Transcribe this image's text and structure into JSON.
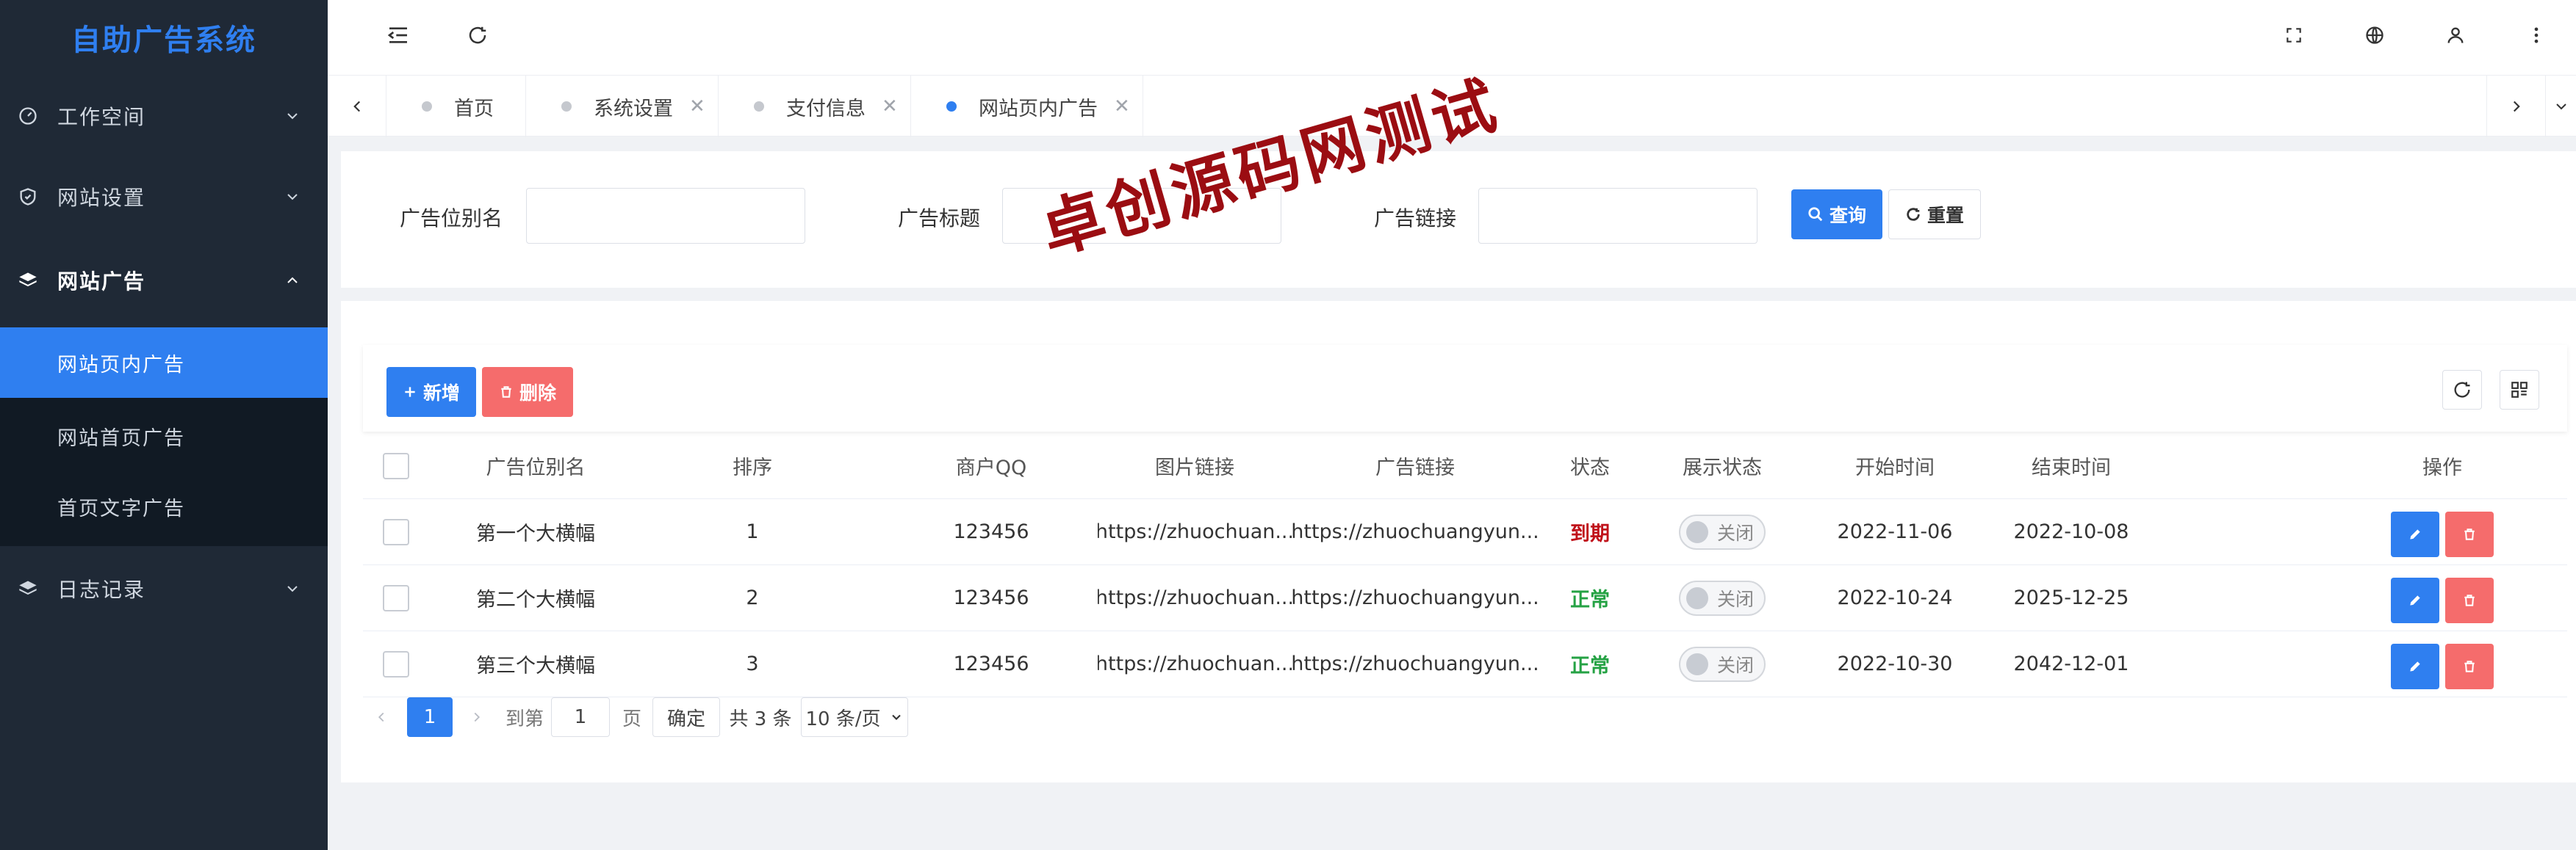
{
  "app": {
    "title": "自助广告系统"
  },
  "sidebar": {
    "items": [
      {
        "label": "工作空间",
        "icon": "dashboard-icon"
      },
      {
        "label": "网站设置",
        "icon": "shield-icon"
      },
      {
        "label": "网站广告",
        "icon": "layers-icon"
      },
      {
        "label": "日志记录",
        "icon": "layers-icon"
      }
    ],
    "sub_items": [
      {
        "label": "网站页内广告"
      },
      {
        "label": "网站首页广告"
      },
      {
        "label": "首页文字广告"
      }
    ]
  },
  "tabs": [
    {
      "label": "首页"
    },
    {
      "label": "系统设置"
    },
    {
      "label": "支付信息"
    },
    {
      "label": "网站页内广告"
    }
  ],
  "search": {
    "field1_label": "广告位别名",
    "field2_label": "广告标题",
    "field3_label": "广告链接",
    "query_label": "查询",
    "reset_label": "重置"
  },
  "toolbar": {
    "add_label": "新增",
    "delete_label": "删除"
  },
  "table": {
    "headers": [
      "广告位别名",
      "排序",
      "商户QQ",
      "图片链接",
      "广告链接",
      "状态",
      "展示状态",
      "开始时间",
      "结束时间",
      "操作"
    ],
    "rows": [
      {
        "name": "第一个大横幅",
        "sort": "1",
        "qq": "123456",
        "img": "https://zhuochuan...",
        "link": "https://zhuochuangyun...",
        "status": "到期",
        "display": "关闭",
        "start": "2022-11-06",
        "end": "2022-10-08"
      },
      {
        "name": "第二个大横幅",
        "sort": "2",
        "qq": "123456",
        "img": "https://zhuochuan...",
        "link": "https://zhuochuangyun...",
        "status": "正常",
        "display": "关闭",
        "start": "2022-10-24",
        "end": "2025-12-25"
      },
      {
        "name": "第三个大横幅",
        "sort": "3",
        "qq": "123456",
        "img": "https://zhuochuan...",
        "link": "https://zhuochuangyun...",
        "status": "正常",
        "display": "关闭",
        "start": "2022-10-30",
        "end": "2042-12-01"
      }
    ]
  },
  "pagination": {
    "current": "1",
    "goto_label": "到第",
    "goto_value": "1",
    "page_label": "页",
    "confirm_label": "确定",
    "total_label": "共 3 条",
    "page_size": "10 条/页"
  },
  "watermark": "卓创源码网测试",
  "colors": {
    "accent": "#2f7ff0",
    "danger": "#f56c6c",
    "sidebar": "#1f2936",
    "expired": "#c0111a",
    "normal": "#25a244"
  }
}
